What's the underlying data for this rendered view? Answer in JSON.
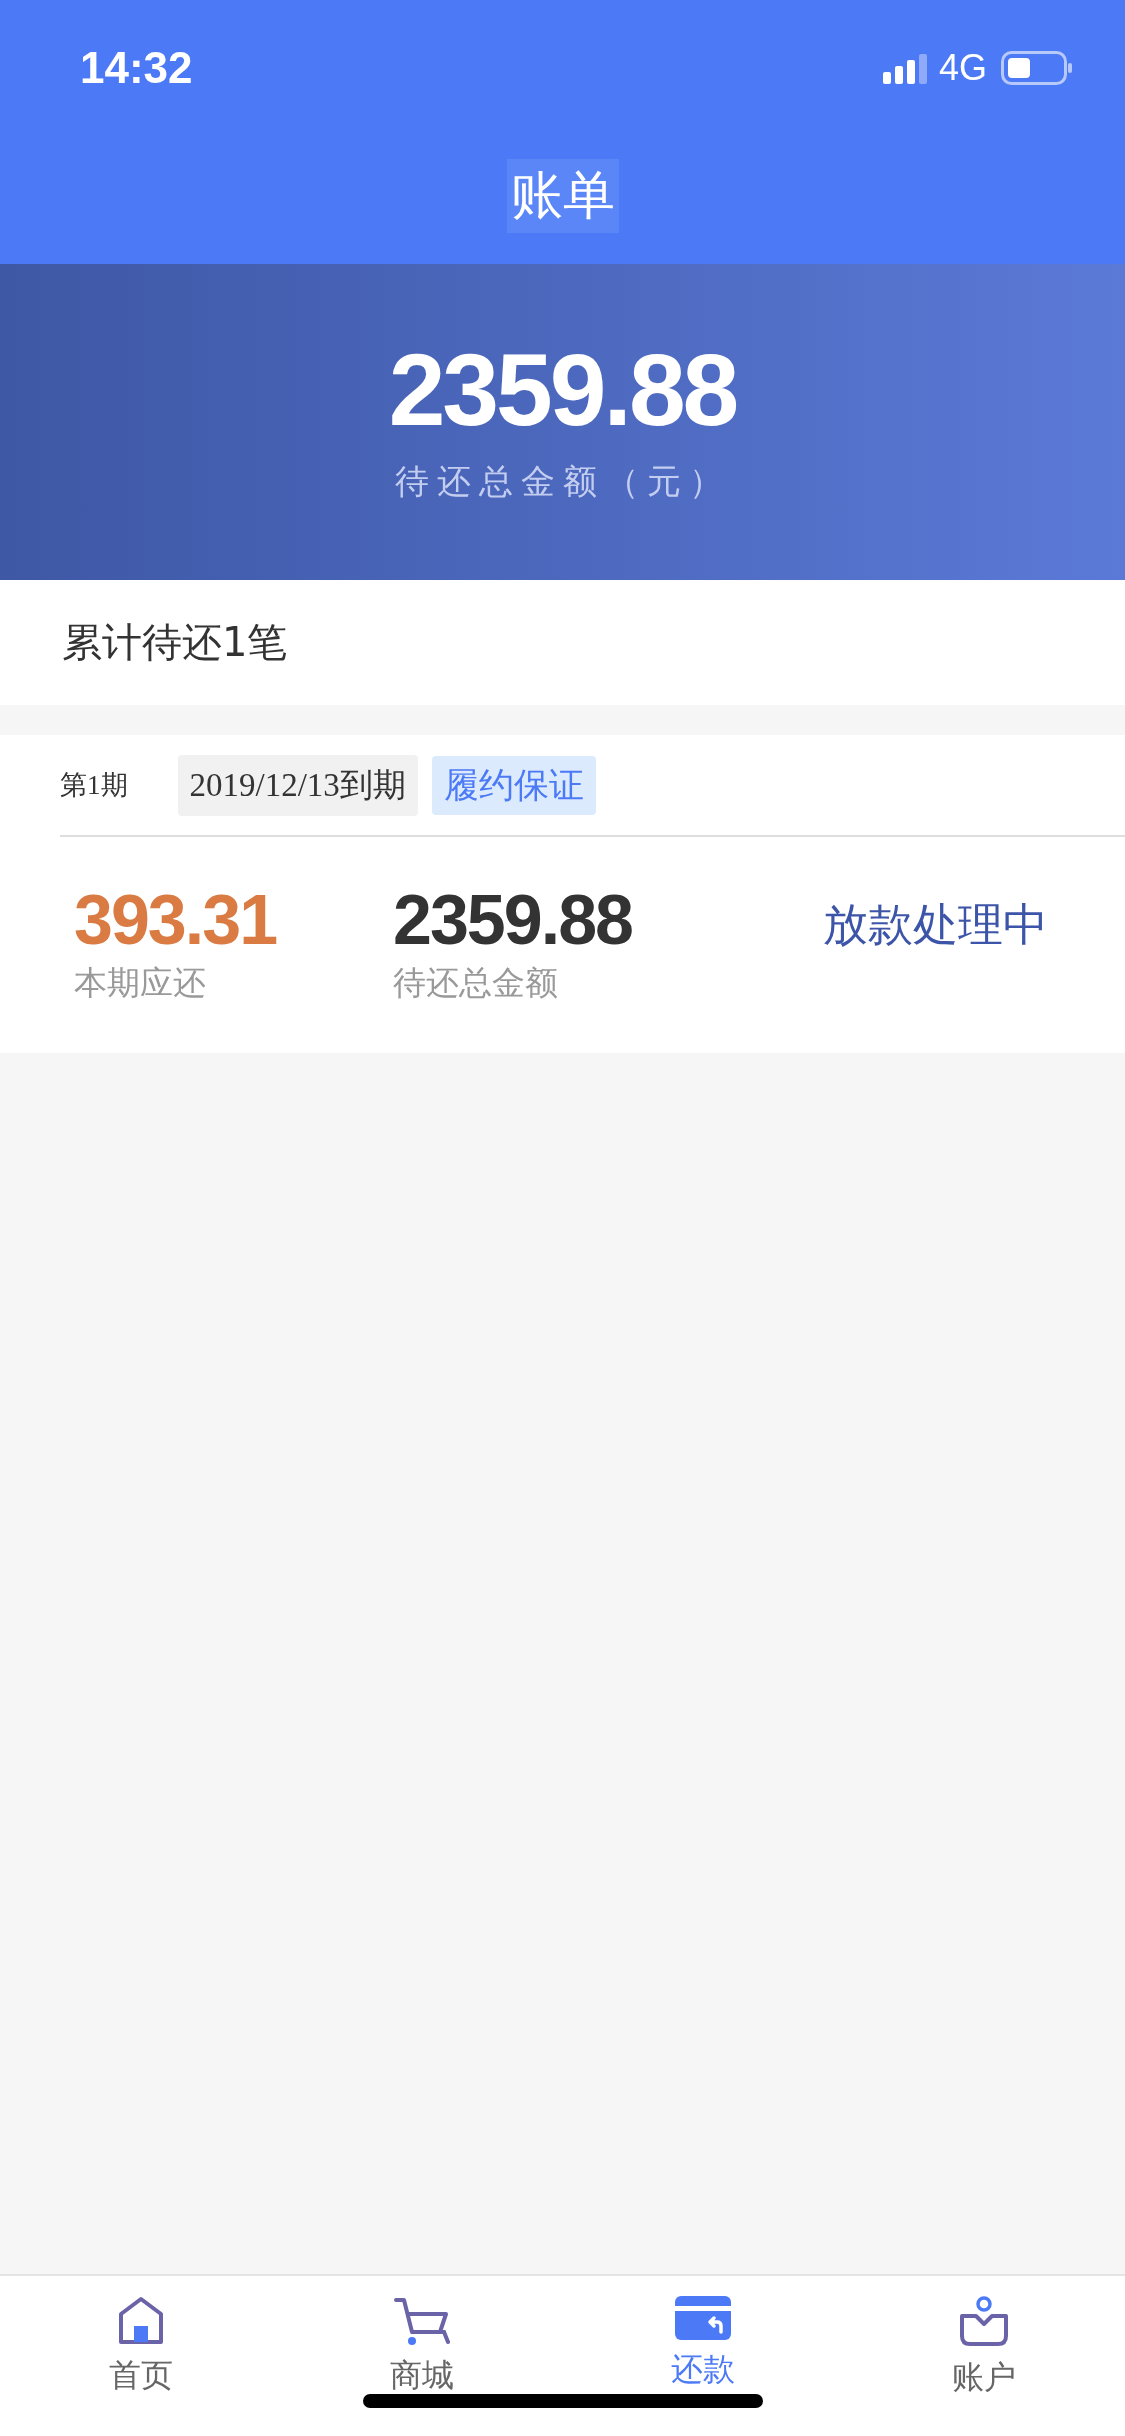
{
  "status_bar": {
    "time": "14:32",
    "network": "4G"
  },
  "header": {
    "title": "账单"
  },
  "summary": {
    "amount": "2359.88",
    "caption": "待还总金额（元）"
  },
  "count_line": "累计待还1笔",
  "bills": [
    {
      "period": "第1期",
      "due": "2019/12/13到期",
      "tag": "履约保证",
      "current_amount": "393.31",
      "current_label": "本期应还",
      "total_amount": "2359.88",
      "total_label": "待还总金额",
      "status": "放款处理中"
    }
  ],
  "tab_bar": [
    {
      "label": "首页",
      "selected": false
    },
    {
      "label": "商城",
      "selected": false
    },
    {
      "label": "还款",
      "selected": true
    },
    {
      "label": "账户",
      "selected": false
    }
  ]
}
